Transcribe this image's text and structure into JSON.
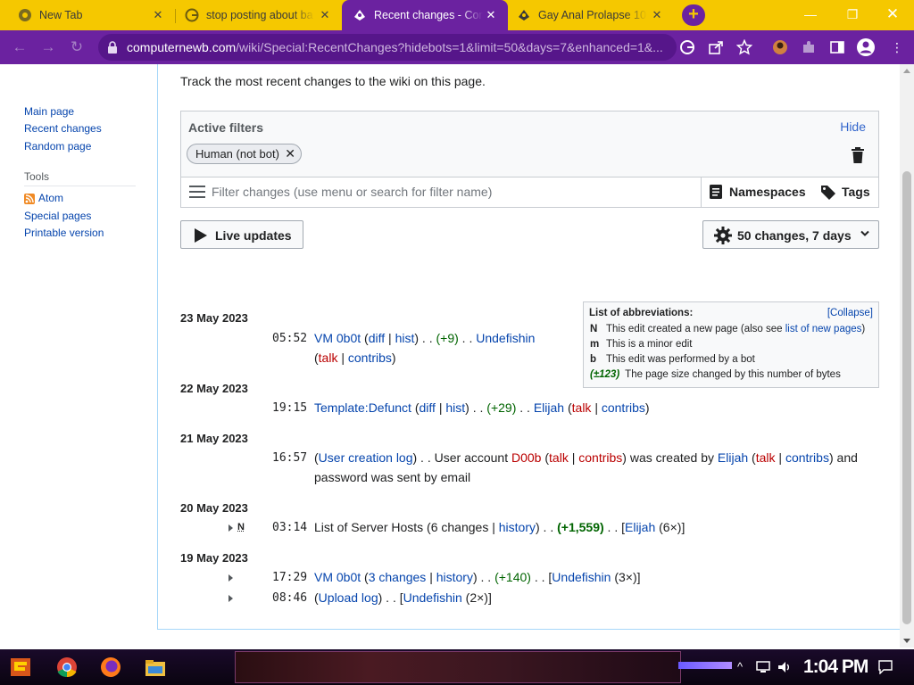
{
  "browser": {
    "tabs": [
      {
        "title": "New Tab",
        "icon": "chrome-icon"
      },
      {
        "title": "stop posting about ba",
        "icon": "google-icon"
      },
      {
        "title": "Recent changes - Com",
        "icon": "wiki-icon"
      },
      {
        "title": "Gay Anal Prolapse 10",
        "icon": "wiki-icon"
      }
    ],
    "new_tab": "+",
    "window": {
      "minimize": "—",
      "restore": "❐",
      "close": "✕"
    },
    "url_host": "computernewb.com",
    "url_path": "/wiki/Special:RecentChanges?hidebots=1&limit=50&days=7&enhanced=1&..."
  },
  "sidebar": {
    "nav": [
      "Main page",
      "Recent changes",
      "Random page"
    ],
    "tools_heading": "Tools",
    "tools": [
      "Atom",
      "Special pages",
      "Printable version"
    ]
  },
  "page": {
    "intro": "Track the most recent changes to the wiki on this page.",
    "filters": {
      "label": "Active filters",
      "hide": "Hide",
      "chip": "Human (not bot)",
      "placeholder": "Filter changes (use menu or search for filter name)",
      "namespaces": "Namespaces",
      "tags": "Tags"
    },
    "live_updates": "Live updates",
    "changes_setting": "50 changes, 7 days",
    "abbr": {
      "title": "List of abbreviations:",
      "collapse": "[Collapse]",
      "rows": [
        {
          "k": "N",
          "pre": "This edit created a new page (also see ",
          "link": "list of new pages",
          "post": ")"
        },
        {
          "k": "m",
          "text": "This is a minor edit"
        },
        {
          "k": "b",
          "text": "This edit was performed by a bot"
        },
        {
          "k": "(±123)",
          "text": "The page size changed by this number of bytes"
        }
      ]
    },
    "days": [
      {
        "date": "23 May 2023"
      },
      {
        "date": "22 May 2023"
      },
      {
        "date": "21 May 2023"
      },
      {
        "date": "20 May 2023"
      },
      {
        "date": "19 May 2023"
      }
    ],
    "entries": {
      "e1": {
        "time": "05:52",
        "title": "VM 0b0t",
        "diff": "diff",
        "hist": "hist",
        "size": "(+9)",
        "user": "Undefishin",
        "talk": "talk",
        "contribs": "contribs"
      },
      "e2": {
        "time": "19:15",
        "title": "Template:Defunct",
        "diff": "diff",
        "hist": "hist",
        "size": "(+29)",
        "user": "Elijah",
        "talk": "talk",
        "contribs": "contribs"
      },
      "e3": {
        "time": "16:57",
        "log": "User creation log",
        "mid": "User account",
        "account": "D00b",
        "talk": "talk",
        "contribs": "contribs",
        "by": "was created by",
        "user": "Elijah",
        "end": "and",
        "line2": "password was sent by email"
      },
      "e4": {
        "flag": "N",
        "time": "03:14",
        "title": "List of Server Hosts",
        "changes": "6 changes",
        "history": "history",
        "size": "(+1,559)",
        "user": "Elijah",
        "count": "(6×)"
      },
      "e5": {
        "time": "17:29",
        "title": "VM 0b0t",
        "changes": "3 changes",
        "history": "history",
        "size": "(+140)",
        "user": "Undefishin",
        "count": "(3×)"
      },
      "e6": {
        "time": "08:46",
        "log": "Upload log",
        "user": "Undefishin",
        "count": "(2×)"
      }
    }
  },
  "taskbar": {
    "clock": "1:04 PM"
  },
  "colors": {
    "tab_bar": "#f5c800",
    "toolbar": "#6b22a0",
    "link": "#0645ad",
    "redlink": "#ba0000",
    "positive": "#006400"
  }
}
